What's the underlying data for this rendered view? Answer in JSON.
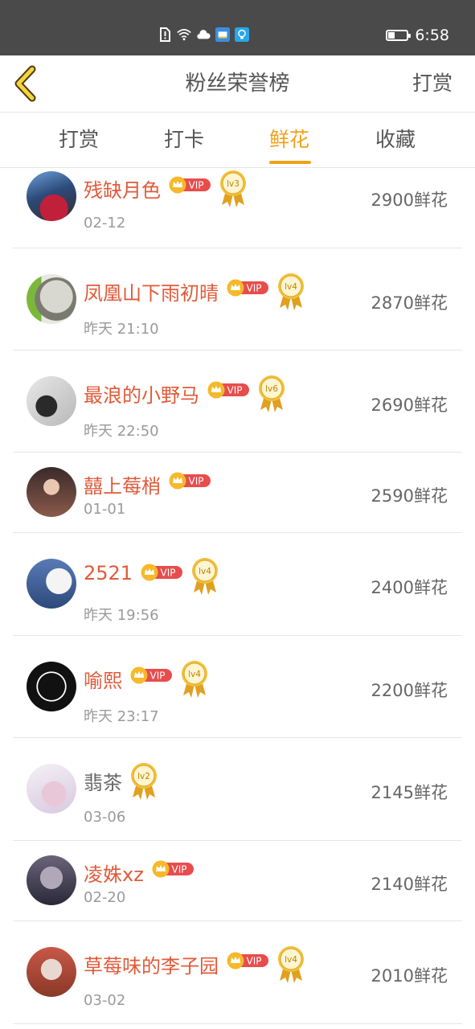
{
  "status_bar": {
    "time": "6:58",
    "icons": [
      "alert-icon",
      "wifi-icon",
      "cloud-icon",
      "message-app-icon",
      "bulb-app-icon"
    ],
    "battery_level": 0.35
  },
  "header": {
    "title": "粉丝荣誉榜",
    "action": "打赏"
  },
  "tabs": [
    {
      "label": "打赏",
      "active": false
    },
    {
      "label": "打卡",
      "active": false
    },
    {
      "label": "鲜花",
      "active": true
    },
    {
      "label": "收藏",
      "active": false
    }
  ],
  "colors": {
    "accent": "#f0a21a",
    "vip_name": "#e05a3a",
    "normal_name": "#666666",
    "vip_badge": "#e84c4c",
    "crown": "#f5b92a"
  },
  "list": [
    {
      "name": "残缺月色",
      "vip": true,
      "vip_label": "VIP",
      "level": "lv3",
      "date": "02-12",
      "amount": "2900鲜花"
    },
    {
      "name": "凤凰山下雨初晴",
      "vip": true,
      "vip_label": "VIP",
      "level": "lv4",
      "date": "昨天 21:10",
      "amount": "2870鲜花"
    },
    {
      "name": "最浪的小野马",
      "vip": true,
      "vip_label": "VIP",
      "level": "lv6",
      "date": "昨天 22:50",
      "amount": "2690鲜花"
    },
    {
      "name": "囍上莓梢",
      "vip": true,
      "vip_label": "VIP",
      "level": "",
      "date": "01-01",
      "amount": "2590鲜花"
    },
    {
      "name": "2521",
      "vip": true,
      "vip_label": "VIP",
      "level": "lv4",
      "date": "昨天 19:56",
      "amount": "2400鲜花"
    },
    {
      "name": "喻熙",
      "vip": true,
      "vip_label": "VIP",
      "level": "lv4",
      "date": "昨天 23:17",
      "amount": "2200鲜花"
    },
    {
      "name": "翡茶",
      "vip": false,
      "vip_label": "",
      "level": "lv2",
      "date": "03-06",
      "amount": "2145鲜花"
    },
    {
      "name": "凌姝xz",
      "vip": true,
      "vip_label": "VIP",
      "level": "",
      "date": "02-20",
      "amount": "2140鲜花"
    },
    {
      "name": "草莓味的李子园",
      "vip": true,
      "vip_label": "VIP",
      "level": "lv4",
      "date": "03-02",
      "amount": "2010鲜花"
    }
  ]
}
